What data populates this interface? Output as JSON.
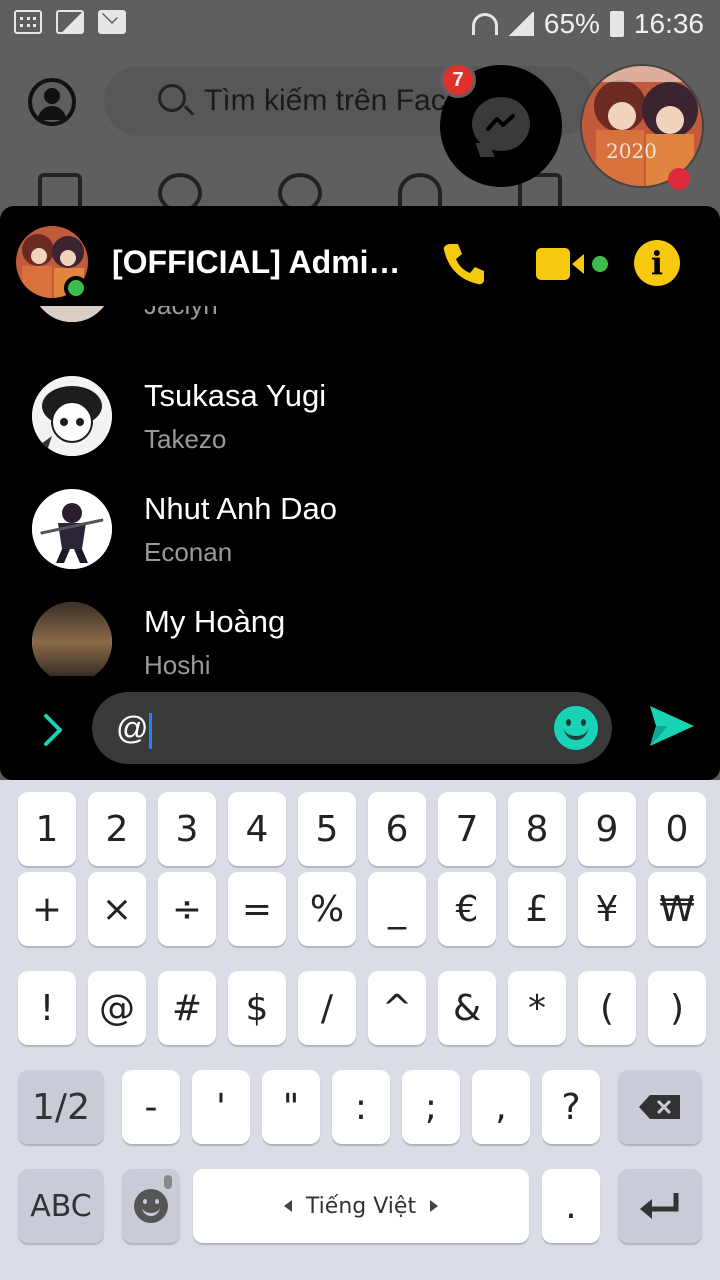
{
  "statusbar": {
    "battery": "65%",
    "time": "16:36"
  },
  "facebook": {
    "search_placeholder": "Tìm kiếm trên Facebook"
  },
  "chat_head": {
    "badge_count": "7",
    "avatar_text": "2020"
  },
  "chat": {
    "title": "[OFFICIAL] Admin...",
    "colors": {
      "accent": "#f6c90e",
      "composer_accent": "#19d3b7",
      "online": "#3cbd4e"
    }
  },
  "mentions": [
    {
      "name": "",
      "sub": "Jaclyn"
    },
    {
      "name": "Tsukasa Yugi",
      "sub": "Takezo"
    },
    {
      "name": "Nhut Anh Dao",
      "sub": "Econan"
    },
    {
      "name": "My Hoàng",
      "sub": "Hoshi"
    }
  ],
  "composer": {
    "value": "@"
  },
  "keyboard": {
    "row1": [
      "1",
      "2",
      "3",
      "4",
      "5",
      "6",
      "7",
      "8",
      "9",
      "0"
    ],
    "row2": [
      "+",
      "×",
      "÷",
      "=",
      "%",
      "_",
      "€",
      "£",
      "¥",
      "₩"
    ],
    "row3": [
      "!",
      "@",
      "#",
      "$",
      "/",
      "^",
      "&",
      "*",
      "(",
      ")"
    ],
    "row4": [
      "-",
      "'",
      "\"",
      ":",
      ";",
      ",",
      "?"
    ],
    "page_toggle": "1/2",
    "abc": "ABC",
    "language": "Tiếng Việt",
    "period": "."
  }
}
